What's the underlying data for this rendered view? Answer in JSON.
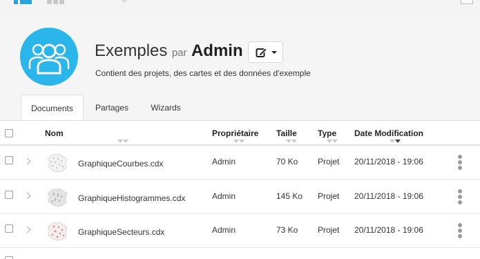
{
  "header": {
    "title": "Exemples",
    "by": "par",
    "owner": "Admin",
    "description": "Contient des projets, des cartes et des données d'exemple"
  },
  "tabs": [
    {
      "label": "Documents",
      "active": true
    },
    {
      "label": "Partages",
      "active": false
    },
    {
      "label": "Wizards",
      "active": false
    }
  ],
  "columns": {
    "name": "Nom",
    "owner": "Propriétaire",
    "size": "Taille",
    "type": "Type",
    "modified": "Date Modification"
  },
  "sort": {
    "column": "modified",
    "direction": "descending"
  },
  "rows": [
    {
      "name": "GraphiqueCourbes.cdx",
      "owner": "Admin",
      "size": "70 Ko",
      "type": "Projet",
      "modified": "20/11/2018 - 19:06",
      "thumb_color": "#9aa4ad"
    },
    {
      "name": "GraphiqueHistogrammes.cdx",
      "owner": "Admin",
      "size": "145 Ko",
      "type": "Projet",
      "modified": "20/11/2018 - 19:06",
      "thumb_color": "#b5b5b5"
    },
    {
      "name": "GraphiqueSecteurs.cdx",
      "owner": "Admin",
      "size": "73 Ko",
      "type": "Projet",
      "modified": "20/11/2018 - 19:06",
      "thumb_color": "#c97a7a"
    }
  ],
  "colors": {
    "accent": "#2aa3d6",
    "avatar": "#2ab6ea"
  },
  "icons": {
    "avatar": "users-group-icon",
    "edit": "edit-icon",
    "row_expand": "chevron-right-icon",
    "row_menu": "more-vertical-icon",
    "view_list": "list-view-icon",
    "view_grid": "grid-view-icon"
  }
}
